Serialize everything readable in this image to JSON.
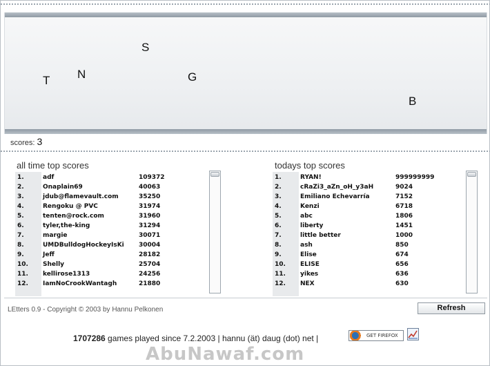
{
  "game": {
    "letters": [
      "S",
      "T",
      "N",
      "G",
      "B"
    ]
  },
  "scores": {
    "label": "scores:",
    "value": "3"
  },
  "all_time": {
    "title": "all time top scores",
    "rows": [
      {
        "rank": "1.",
        "name": "adf",
        "score": "109372"
      },
      {
        "rank": "2.",
        "name": "Onaplain69",
        "score": "40063"
      },
      {
        "rank": "3.",
        "name": "jdub@flamevault.com",
        "score": "35250"
      },
      {
        "rank": "4.",
        "name": "Rengoku @ PVC",
        "score": "31974"
      },
      {
        "rank": "5.",
        "name": "tenten@rock.com",
        "score": "31960"
      },
      {
        "rank": "6.",
        "name": "tyler,the-king",
        "score": "31294"
      },
      {
        "rank": "7.",
        "name": "margie",
        "score": "30071"
      },
      {
        "rank": "8.",
        "name": "UMDBulldogHockeyIsKi",
        "score": "30004"
      },
      {
        "rank": "9.",
        "name": "Jeff",
        "score": "28182"
      },
      {
        "rank": "10.",
        "name": "Shelly",
        "score": "25704"
      },
      {
        "rank": "11.",
        "name": "kellirose1313",
        "score": "24256"
      },
      {
        "rank": "12.",
        "name": "IamNoCrookWantagh",
        "score": "21880"
      }
    ]
  },
  "today": {
    "title": "todays top scores",
    "rows": [
      {
        "rank": "1.",
        "name": "RYAN!",
        "score": "999999999"
      },
      {
        "rank": "2.",
        "name": "cRaZi3_aZn_oH_y3aH",
        "score": "9024"
      },
      {
        "rank": "3.",
        "name": "Emiliano Echevarría",
        "score": "7152"
      },
      {
        "rank": "4.",
        "name": "Kenzi",
        "score": "6718"
      },
      {
        "rank": "5.",
        "name": "abc",
        "score": "1806"
      },
      {
        "rank": "6.",
        "name": "liberty",
        "score": "1451"
      },
      {
        "rank": "7.",
        "name": "little better",
        "score": "1000"
      },
      {
        "rank": "8.",
        "name": "ash",
        "score": "850"
      },
      {
        "rank": "9.",
        "name": "Elise",
        "score": "674"
      },
      {
        "rank": "10.",
        "name": "ELISE",
        "score": "656"
      },
      {
        "rank": "11.",
        "name": "yikes",
        "score": "636"
      },
      {
        "rank": "12.",
        "name": "NEX",
        "score": "630"
      }
    ]
  },
  "footer": {
    "copyright": "LEtters 0.9 - Copyright © 2003 by Hannu Pelkonen",
    "refresh_label": "Refresh",
    "games_count": "1707286",
    "games_text": " games played since 7.2.2003 | hannu (ät) daug (dot) net |",
    "firefox_label": "GET FIREFOX",
    "icons": {
      "firefox": "firefox-globe-icon",
      "stats": "stats-chart-icon"
    }
  },
  "watermark": "AbuNawaf.com"
}
